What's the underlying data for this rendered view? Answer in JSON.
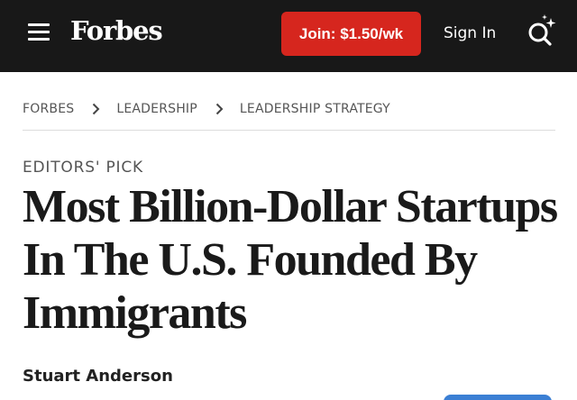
{
  "header": {
    "brand": "Forbes",
    "join_label": "Join: $1.50/wk",
    "signin_label": "Sign In",
    "menu_icon": "hamburger-menu-icon",
    "search_icon": "search-sparkle-icon"
  },
  "breadcrumb": [
    {
      "label": "FORBES"
    },
    {
      "label": "LEADERSHIP"
    },
    {
      "label": "LEADERSHIP STRATEGY"
    }
  ],
  "article": {
    "kicker": "EDITORS' PICK",
    "headline_lines": [
      "Most Billion-Dollar Startups",
      "In The U.S. Founded By",
      "Immigrants"
    ],
    "author": "Stuart Anderson"
  },
  "colors": {
    "header_bg": "#181818",
    "join_button": "#d6261e",
    "follow_button": "#3b7fd4"
  }
}
